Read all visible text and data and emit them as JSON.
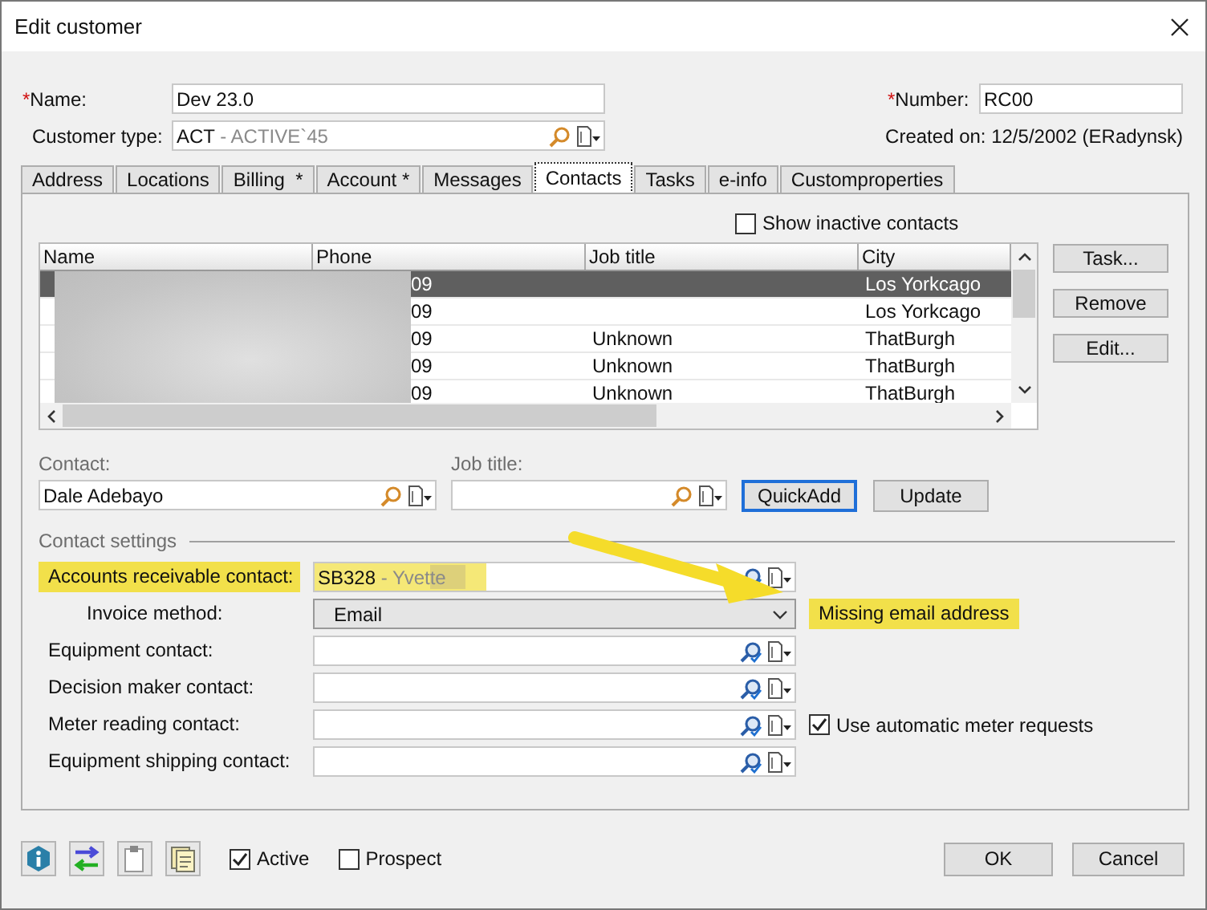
{
  "window": {
    "title": "Edit customer"
  },
  "header": {
    "name": {
      "label": "Name:",
      "required_mark": "*",
      "value": "Dev 23.0"
    },
    "customer_type": {
      "label": "Customer type:",
      "code": "ACT",
      "description": " - ACTIVE`45"
    },
    "number": {
      "label": "Number:",
      "required_mark": "*",
      "value": "RC00"
    },
    "created": "Created on: 12/5/2002 (ERadynsk)"
  },
  "tabs": [
    {
      "label": "Address",
      "selected": false
    },
    {
      "label": "Locations",
      "selected": false
    },
    {
      "label": "Billing  *",
      "selected": false
    },
    {
      "label": "Account *",
      "selected": false
    },
    {
      "label": "Messages",
      "selected": false
    },
    {
      "label": "Contacts",
      "selected": true
    },
    {
      "label": "Tasks",
      "selected": false
    },
    {
      "label": "e-info",
      "selected": false
    },
    {
      "label": "Customproperties",
      "selected": false
    }
  ],
  "contacts": {
    "show_inactive": {
      "label": "Show inactive contacts",
      "checked": false
    },
    "table": {
      "columns": [
        "Name",
        "Phone",
        "Job title",
        "City"
      ],
      "rows": [
        {
          "phone": "09",
          "city": "Los Yorkcago",
          "selected": true
        },
        {
          "phone": "09",
          "city": "Los Yorkcago",
          "selected": false
        },
        {
          "phone": "09",
          "job_title": "Unknown",
          "city": "ThatBurgh",
          "selected": false
        },
        {
          "phone": "09",
          "job_title": "Unknown",
          "city": "ThatBurgh",
          "selected": false
        },
        {
          "phone": "09",
          "job_title": "Unknown",
          "city": "ThatBurgh",
          "selected": false
        }
      ]
    },
    "side_buttons": [
      "Task...",
      "Remove",
      "Edit..."
    ],
    "contact": {
      "label": "Contact:",
      "value": "Dale Adebayo"
    },
    "job_title": {
      "label": "Job title:"
    },
    "actions": [
      {
        "label": "QuickAdd",
        "default": true
      },
      {
        "label": "Update",
        "default": false
      }
    ]
  },
  "contact_settings": {
    "title": "Contact settings",
    "rows": [
      {
        "kind": "lookup",
        "label": "Accounts receivable contact:",
        "code": "SB328",
        "description": " - Yvette",
        "highlighted": true
      },
      {
        "kind": "dropdown",
        "label": "Invoice method:",
        "value": "Email",
        "note": "Missing email address"
      },
      {
        "kind": "lookup",
        "label": "Equipment contact:"
      },
      {
        "kind": "lookup",
        "label": "Decision maker contact:"
      },
      {
        "kind": "lookup",
        "label": "Meter reading contact:",
        "option": {
          "label": "Use automatic meter requests",
          "checked": true
        }
      },
      {
        "kind": "lookup",
        "label": "Equipment shipping contact:"
      }
    ]
  },
  "footer": {
    "active": {
      "label": "Active",
      "checked": true
    },
    "prospect": {
      "label": "Prospect",
      "checked": false
    },
    "buttons": [
      "OK",
      "Cancel"
    ]
  }
}
